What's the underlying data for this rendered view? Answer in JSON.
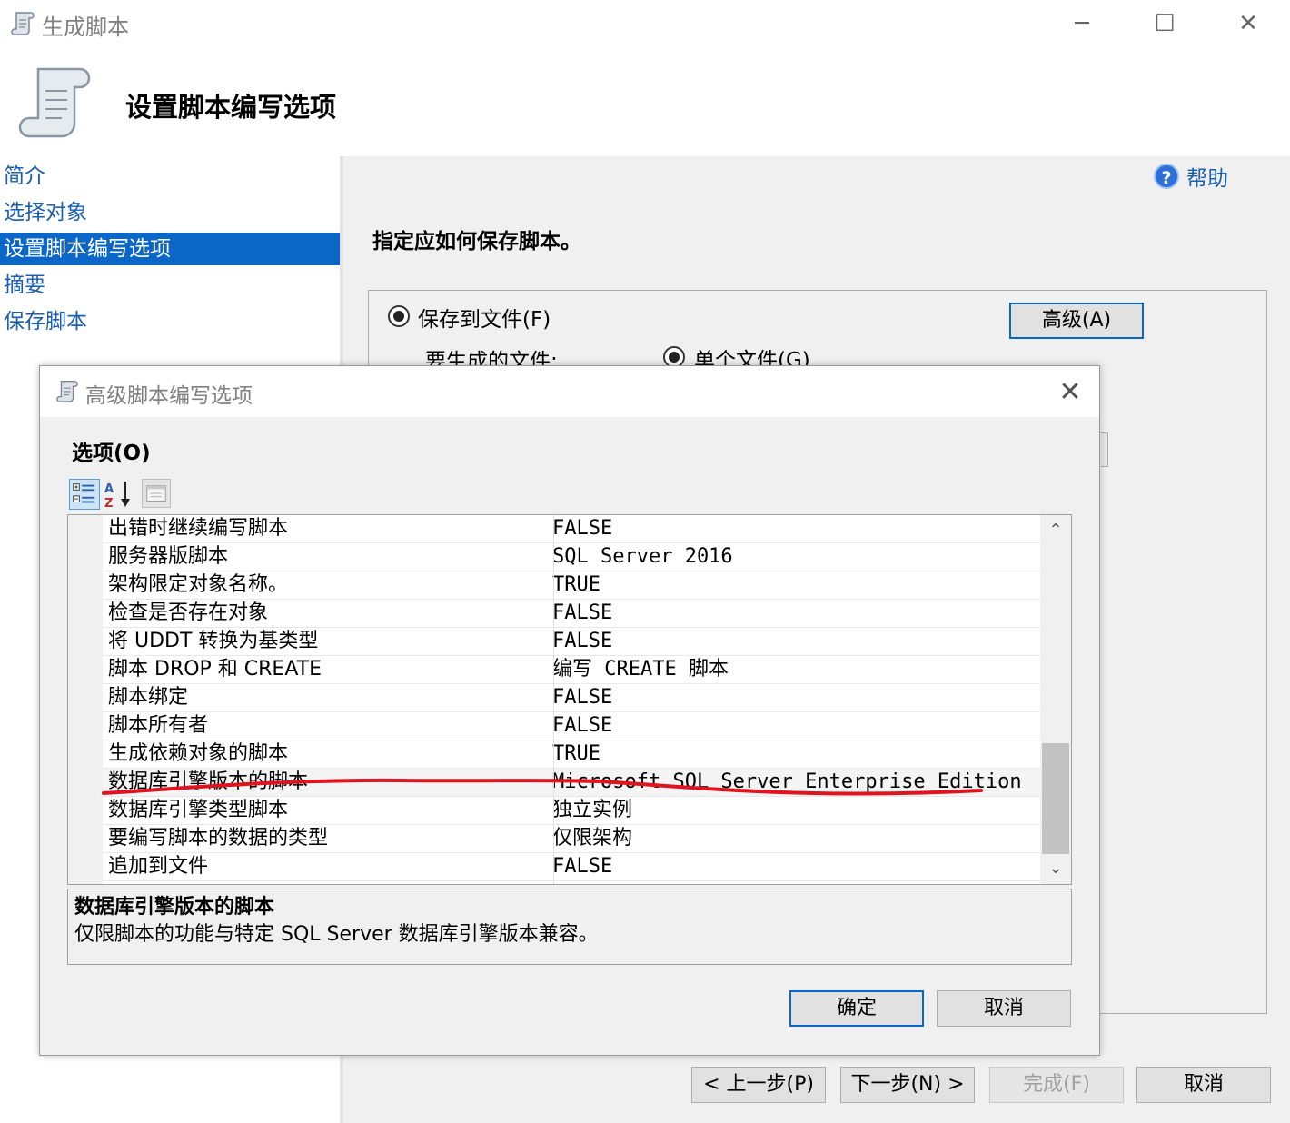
{
  "window": {
    "title": "生成脚本",
    "controls": {
      "minimize": "─",
      "maximize": "☐",
      "close": "✕"
    },
    "icon": "scroll-icon"
  },
  "header": {
    "title": "设置脚本编写选项",
    "icon": "scroll-icon"
  },
  "nav": {
    "items": [
      {
        "label": "简介",
        "active": false
      },
      {
        "label": "选择对象",
        "active": false
      },
      {
        "label": "设置脚本编写选项",
        "active": true
      },
      {
        "label": "摘要",
        "active": false
      },
      {
        "label": "保存脚本",
        "active": false
      }
    ]
  },
  "main": {
    "help_label": "帮助",
    "help_icon_glyph": "?",
    "prompt": "指定应如何保存脚本。",
    "save_to_file_label": "保存到文件(F)",
    "advanced_button": "高级(A)",
    "files_to_generate_label": "要生成的文件:",
    "single_file_label": "单个文件(G)"
  },
  "footer": {
    "prev": "< 上一步(P)",
    "next": "下一步(N) >",
    "finish": "完成(F)",
    "cancel": "取消"
  },
  "dialog": {
    "title": "高级脚本编写选项",
    "close_glyph": "✕",
    "options_label": "选项(O)",
    "grid_rows": [
      {
        "name": "出错时继续编写脚本",
        "value": "FALSE"
      },
      {
        "name": "服务器版脚本",
        "value": "SQL Server 2016"
      },
      {
        "name": "架构限定对象名称。",
        "value": "TRUE"
      },
      {
        "name": "检查是否存在对象",
        "value": "FALSE"
      },
      {
        "name": "将 UDDT 转换为基类型",
        "value": "FALSE"
      },
      {
        "name": "脚本 DROP 和 CREATE",
        "value": "编写 CREATE 脚本"
      },
      {
        "name": "脚本绑定",
        "value": "FALSE"
      },
      {
        "name": "脚本所有者",
        "value": "FALSE"
      },
      {
        "name": "生成依赖对象的脚本",
        "value": "TRUE"
      },
      {
        "name": "数据库引擎版本的脚本",
        "value": "Microsoft SQL Server Enterprise Edition"
      },
      {
        "name": "数据库引擎类型脚本",
        "value": "独立实例"
      },
      {
        "name": "要编写脚本的数据的类型",
        "value": "仅限架构"
      },
      {
        "name": "追加到文件",
        "value": "FALSE"
      }
    ],
    "selected_row_index": 9,
    "description_title": "数据库引擎版本的脚本",
    "description_body": "仅限脚本的功能与特定 SQL Server 数据库引擎版本兼容。",
    "ok": "确定",
    "cancel": "取消",
    "annotation_color": "#e0141e"
  }
}
